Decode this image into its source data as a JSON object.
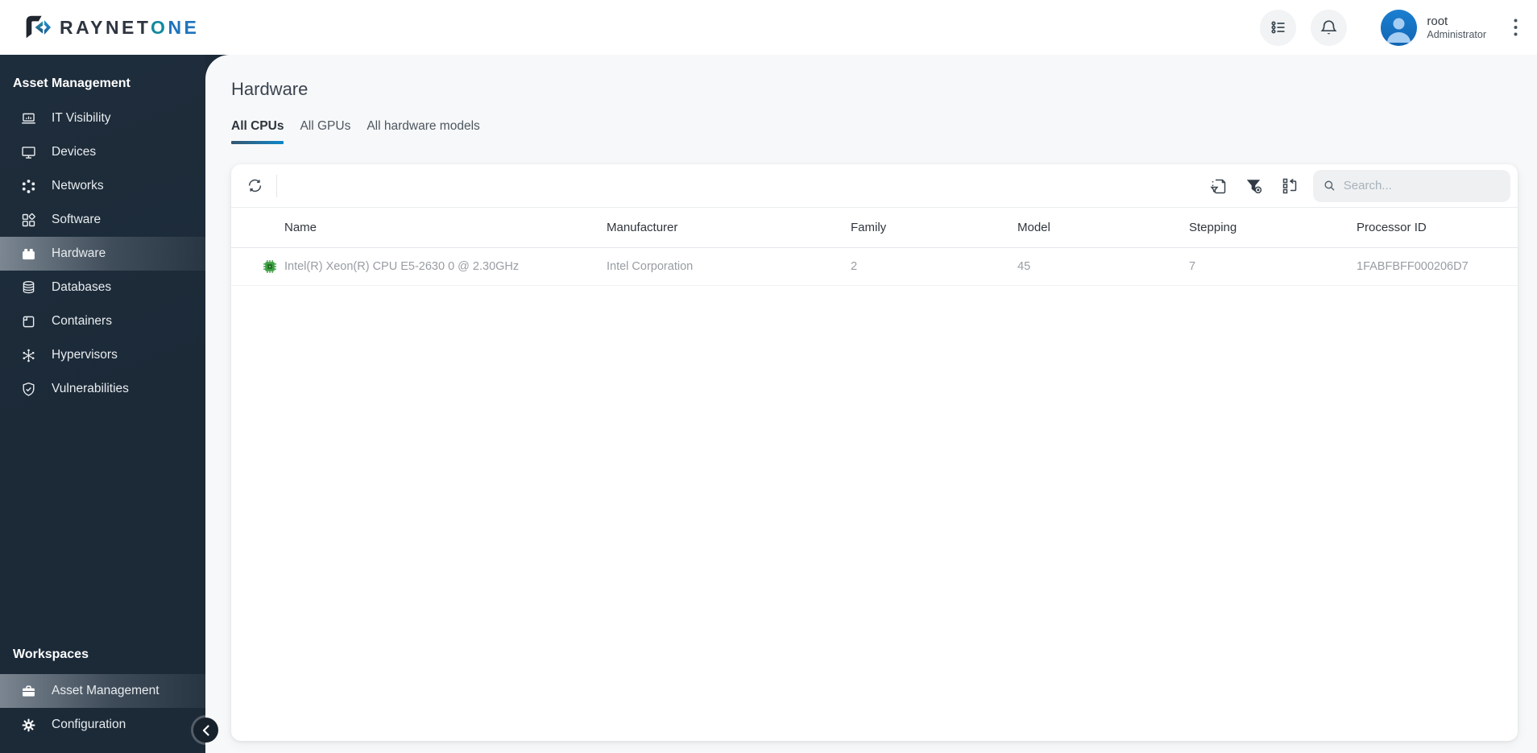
{
  "brand": {
    "word_primary": "RAYNET",
    "word_accent_o": "O",
    "word_accent_ne": "NE"
  },
  "topbar": {
    "user": {
      "name": "root",
      "role": "Administrator"
    }
  },
  "sidebar": {
    "section_title": "Asset Management",
    "items": [
      {
        "label": "IT Visibility",
        "icon": "laptop-chart",
        "active": false
      },
      {
        "label": "Devices",
        "icon": "monitor",
        "active": false
      },
      {
        "label": "Networks",
        "icon": "network-ring",
        "active": false
      },
      {
        "label": "Software",
        "icon": "squares-diamond",
        "active": false
      },
      {
        "label": "Hardware",
        "icon": "hardware-case",
        "active": true
      },
      {
        "label": "Databases",
        "icon": "database-stack",
        "active": false
      },
      {
        "label": "Containers",
        "icon": "container-box",
        "active": false
      },
      {
        "label": "Hypervisors",
        "icon": "hub-spokes",
        "active": false
      },
      {
        "label": "Vulnerabilities",
        "icon": "shield-check",
        "active": false
      }
    ],
    "workspaces_title": "Workspaces",
    "workspace_items": [
      {
        "label": "Asset Management",
        "icon": "briefcase",
        "active": true
      },
      {
        "label": "Configuration",
        "icon": "gear",
        "active": false
      }
    ]
  },
  "page": {
    "title": "Hardware",
    "tabs": [
      {
        "label": "All CPUs",
        "active": true
      },
      {
        "label": "All GPUs",
        "active": false
      },
      {
        "label": "All hardware models",
        "active": false
      }
    ]
  },
  "toolbar": {
    "search_placeholder": "Search..."
  },
  "table": {
    "columns": [
      "Name",
      "Manufacturer",
      "Family",
      "Model",
      "Stepping",
      "Processor ID"
    ],
    "rows": [
      {
        "name": "Intel(R) Xeon(R) CPU E5-2630 0 @ 2.30GHz",
        "manufacturer": "Intel Corporation",
        "family": "2",
        "model": "45",
        "stepping": "7",
        "processor_id": "1FABFBFF000206D7"
      }
    ]
  },
  "colors": {
    "sidebar_bg": "#1c2a38",
    "tab_underline_start": "#33566f",
    "tab_underline_end": "#0d87c9",
    "avatar_blue": "#1b7fd0",
    "cpu_chip_green": "#3fa044",
    "logo_teal": "#12899e",
    "logo_blue": "#1e74bd"
  }
}
